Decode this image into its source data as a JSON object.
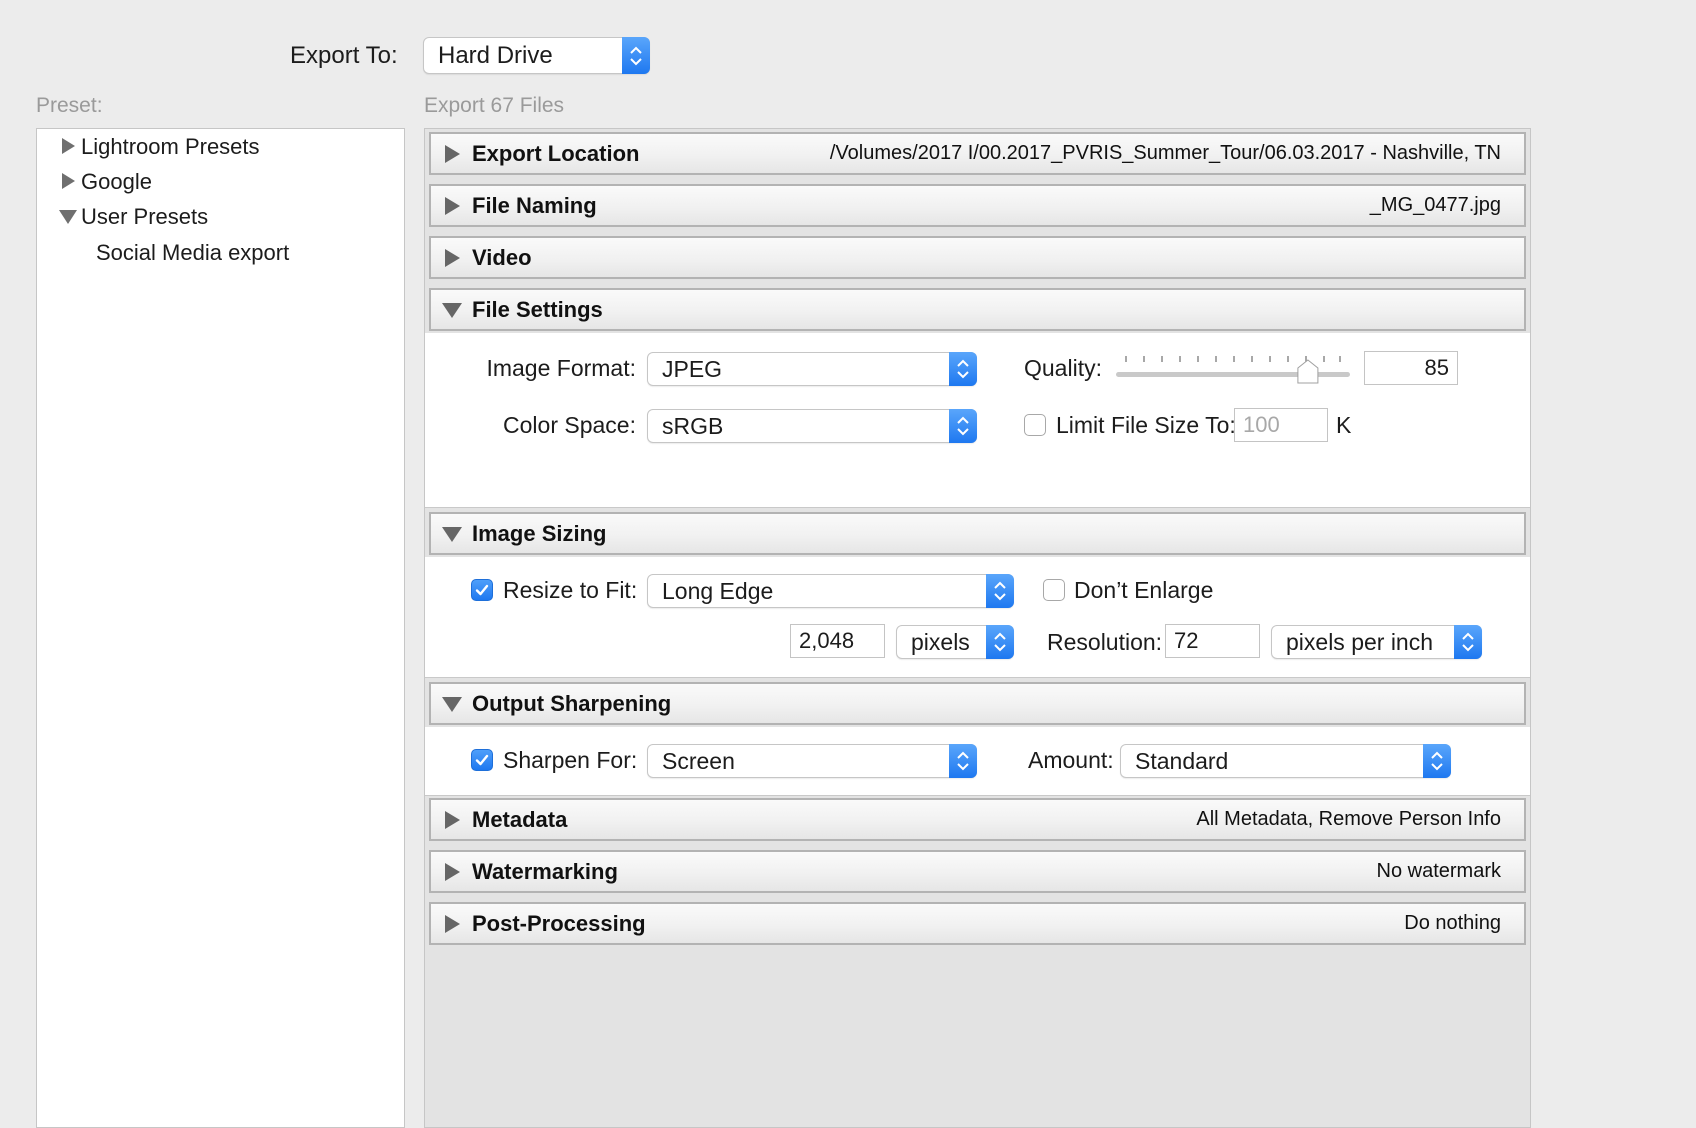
{
  "export_to": {
    "label": "Export To:",
    "value": "Hard Drive"
  },
  "preset": {
    "label": "Preset:",
    "items": [
      {
        "label": "Lightroom Presets",
        "expanded": false
      },
      {
        "label": "Google",
        "expanded": false
      },
      {
        "label": "User Presets",
        "expanded": true
      },
      {
        "label": "Social Media export",
        "child": true
      }
    ]
  },
  "export_count_label": "Export 67 Files",
  "sections": {
    "export_location": {
      "title": "Export Location",
      "summary": "/Volumes/2017 I/00.2017_PVRIS_Summer_Tour/06.03.2017 - Nashville, TN"
    },
    "file_naming": {
      "title": "File Naming",
      "summary": "_MG_0477.jpg"
    },
    "video": {
      "title": "Video",
      "summary": ""
    },
    "file_settings": {
      "title": "File Settings"
    },
    "image_sizing": {
      "title": "Image Sizing"
    },
    "output_sharpening": {
      "title": "Output Sharpening"
    },
    "metadata": {
      "title": "Metadata",
      "summary": "All Metadata, Remove Person Info"
    },
    "watermarking": {
      "title": "Watermarking",
      "summary": "No watermark"
    },
    "post_processing": {
      "title": "Post-Processing",
      "summary": "Do nothing"
    }
  },
  "file_settings": {
    "image_format_label": "Image Format:",
    "image_format": "JPEG",
    "quality_label": "Quality:",
    "quality": "85",
    "quality_fraction": 0.85,
    "color_space_label": "Color Space:",
    "color_space": "sRGB",
    "limit_label": "Limit File Size To:",
    "limit_checked": false,
    "limit_value": "100",
    "limit_unit": "K"
  },
  "image_sizing": {
    "resize_label": "Resize to Fit:",
    "resize_checked": true,
    "resize_mode": "Long Edge",
    "dont_enlarge_label": "Don’t Enlarge",
    "dont_enlarge_checked": false,
    "size_value": "2,048",
    "size_unit": "pixels",
    "resolution_label": "Resolution:",
    "resolution_value": "72",
    "resolution_unit": "pixels per inch"
  },
  "output_sharpening": {
    "sharpen_label": "Sharpen For:",
    "sharpen_checked": true,
    "sharpen_for": "Screen",
    "amount_label": "Amount:",
    "amount": "Standard"
  },
  "colors": {
    "accent": "#1e78f0",
    "window_bg": "#ececec"
  }
}
